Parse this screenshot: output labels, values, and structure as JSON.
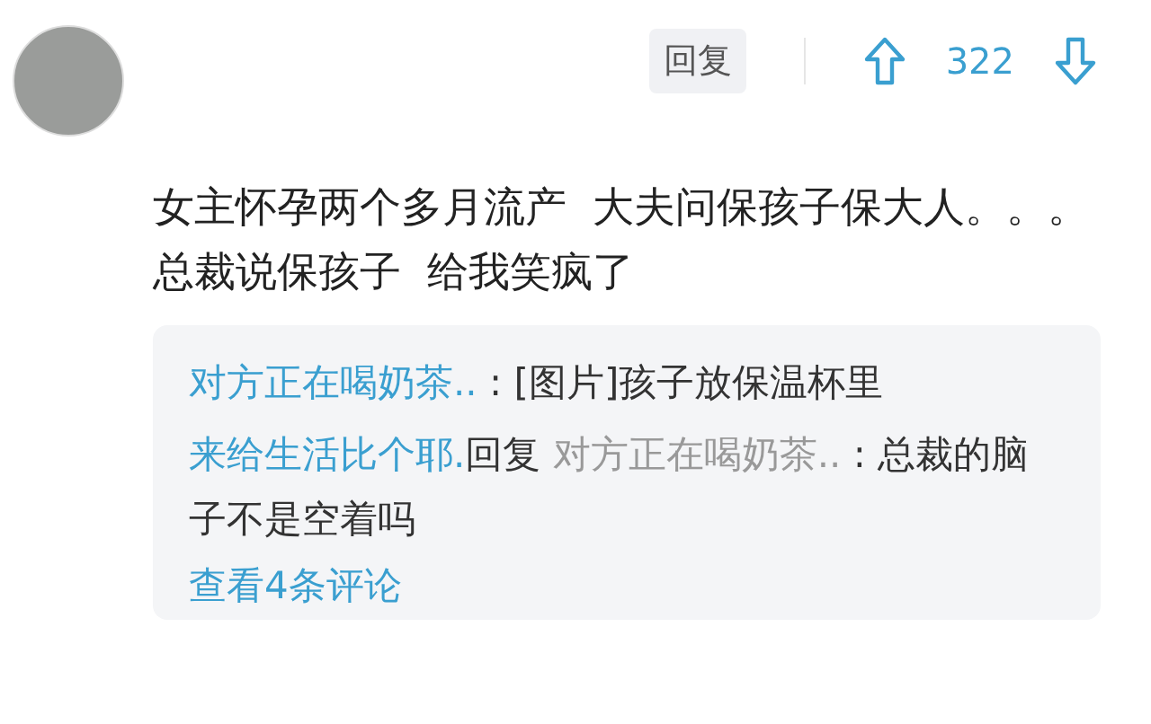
{
  "comment": {
    "reply_button": "回复",
    "vote_count": "322",
    "text": "女主怀孕两个多月流产  大夫问保孩子保大人。。。总裁说保孩子  给我笑疯了"
  },
  "replies": [
    {
      "kind": "plain",
      "author": "对方正在喝奶茶..",
      "text": ": [图片]孩子放保温杯里"
    },
    {
      "kind": "reply-to",
      "author": "来给生活比个耶.",
      "verb": "回复",
      "target": "对方正在喝奶茶..",
      "text": ": 总裁的脑子不是空着吗"
    }
  ],
  "view_more": "查看4条评论"
}
